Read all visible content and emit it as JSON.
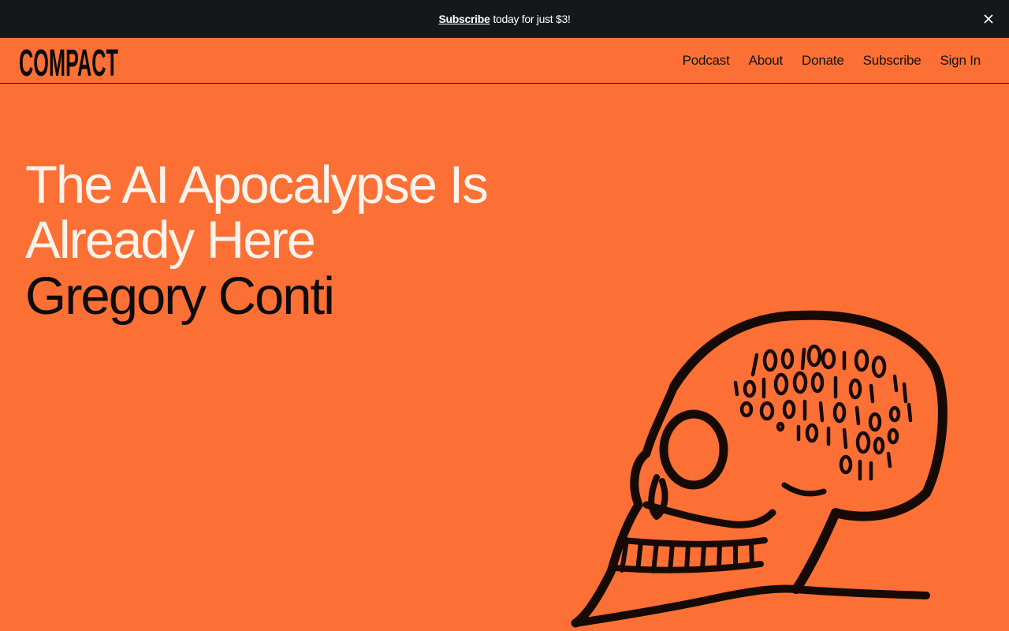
{
  "promo": {
    "link_label": "Subscribe",
    "text": "today for just $3!",
    "close_icon": "close-icon"
  },
  "header": {
    "logo_text": "COMPACT",
    "nav": [
      {
        "label": "Podcast"
      },
      {
        "label": "About"
      },
      {
        "label": "Donate"
      },
      {
        "label": "Subscribe"
      },
      {
        "label": "Sign In"
      }
    ]
  },
  "article": {
    "title": "The AI Apocalypse Is Already Here",
    "author": "Gregory Conti",
    "illustration_icon": "binary-skull-illustration"
  },
  "colors": {
    "background": "#fc7035",
    "promo_bar": "#15171b",
    "title_text": "#fff4ec",
    "ink": "#111111"
  }
}
